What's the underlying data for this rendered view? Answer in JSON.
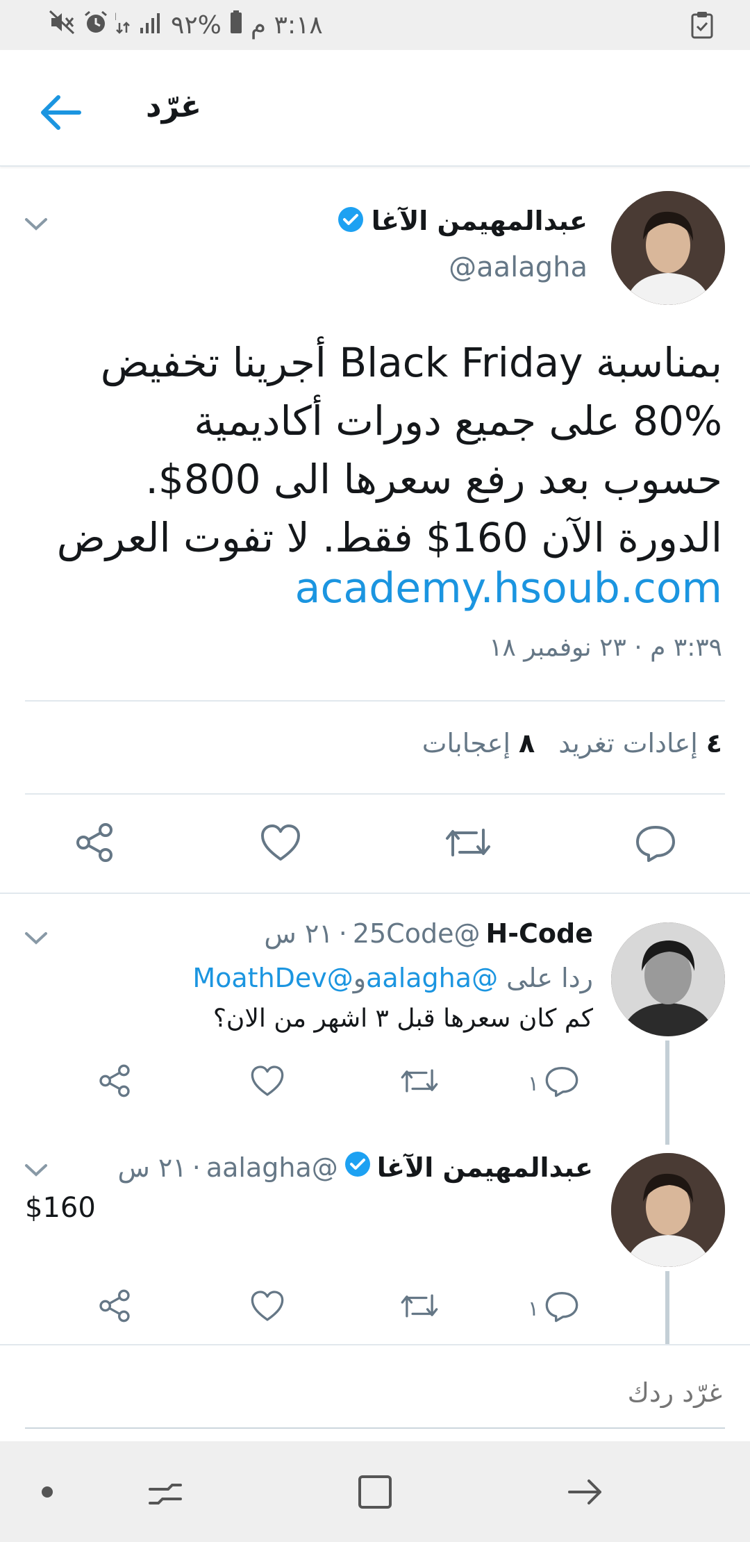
{
  "status_bar": {
    "time": "٣:١٨ م",
    "battery": "%٩٢",
    "icons": [
      "battery-icon",
      "signal-icon",
      "data-icon",
      "alarm-icon",
      "mute-icon",
      "clipboard-icon"
    ]
  },
  "header": {
    "title": "غرّد",
    "back_icon": "back-arrow-icon"
  },
  "main_tweet": {
    "author_name": "عبدالمهيمن الآغا",
    "handle": "@aalagha",
    "verified": true,
    "text_lines": [
      "بمناسبة Black Friday أجرينا تخفيض",
      "80% على جميع دورات أكاديمية",
      "حسوب بعد رفع سعرها الى 800$.",
      "الدورة الآن 160$ فقط. لا تفوت العرض"
    ],
    "link": "academy.hsoub.com",
    "timestamp": "٣:٣٩ م · ٢٣ نوفمبر ١٨",
    "retweets_count": "٤",
    "retweets_label": "إعادات تغريد",
    "likes_count": "٨",
    "likes_label": "إعجابات",
    "actions": [
      "reply-icon",
      "retweet-icon",
      "like-icon",
      "share-icon"
    ]
  },
  "replies": [
    {
      "author_name": "H-Code",
      "handle": "@25Code",
      "time": "٢١ س",
      "verified": false,
      "reply_to_prefix": "ردا على",
      "reply_to_1": "@aalagha",
      "reply_to_join": "و",
      "reply_to_2": "@MoathDev",
      "text": "كم كان سعرها قبل ٣ اشهر من الان؟",
      "reply_count": "١"
    },
    {
      "author_name": "عبدالمهيمن الآغا",
      "handle": "@aalagha",
      "time": "٢١ س",
      "verified": true,
      "text": "$160",
      "reply_count": "١"
    }
  ],
  "reply_box": {
    "placeholder": "غرّد ردك"
  },
  "nav_bar": {
    "icons": [
      "dot-icon",
      "recents-icon",
      "home-square-icon",
      "back-nav-icon"
    ]
  },
  "colors": {
    "accent": "#1b95e0",
    "text_primary": "#14171a",
    "text_secondary": "#657786",
    "divider": "#e1e8ed"
  }
}
